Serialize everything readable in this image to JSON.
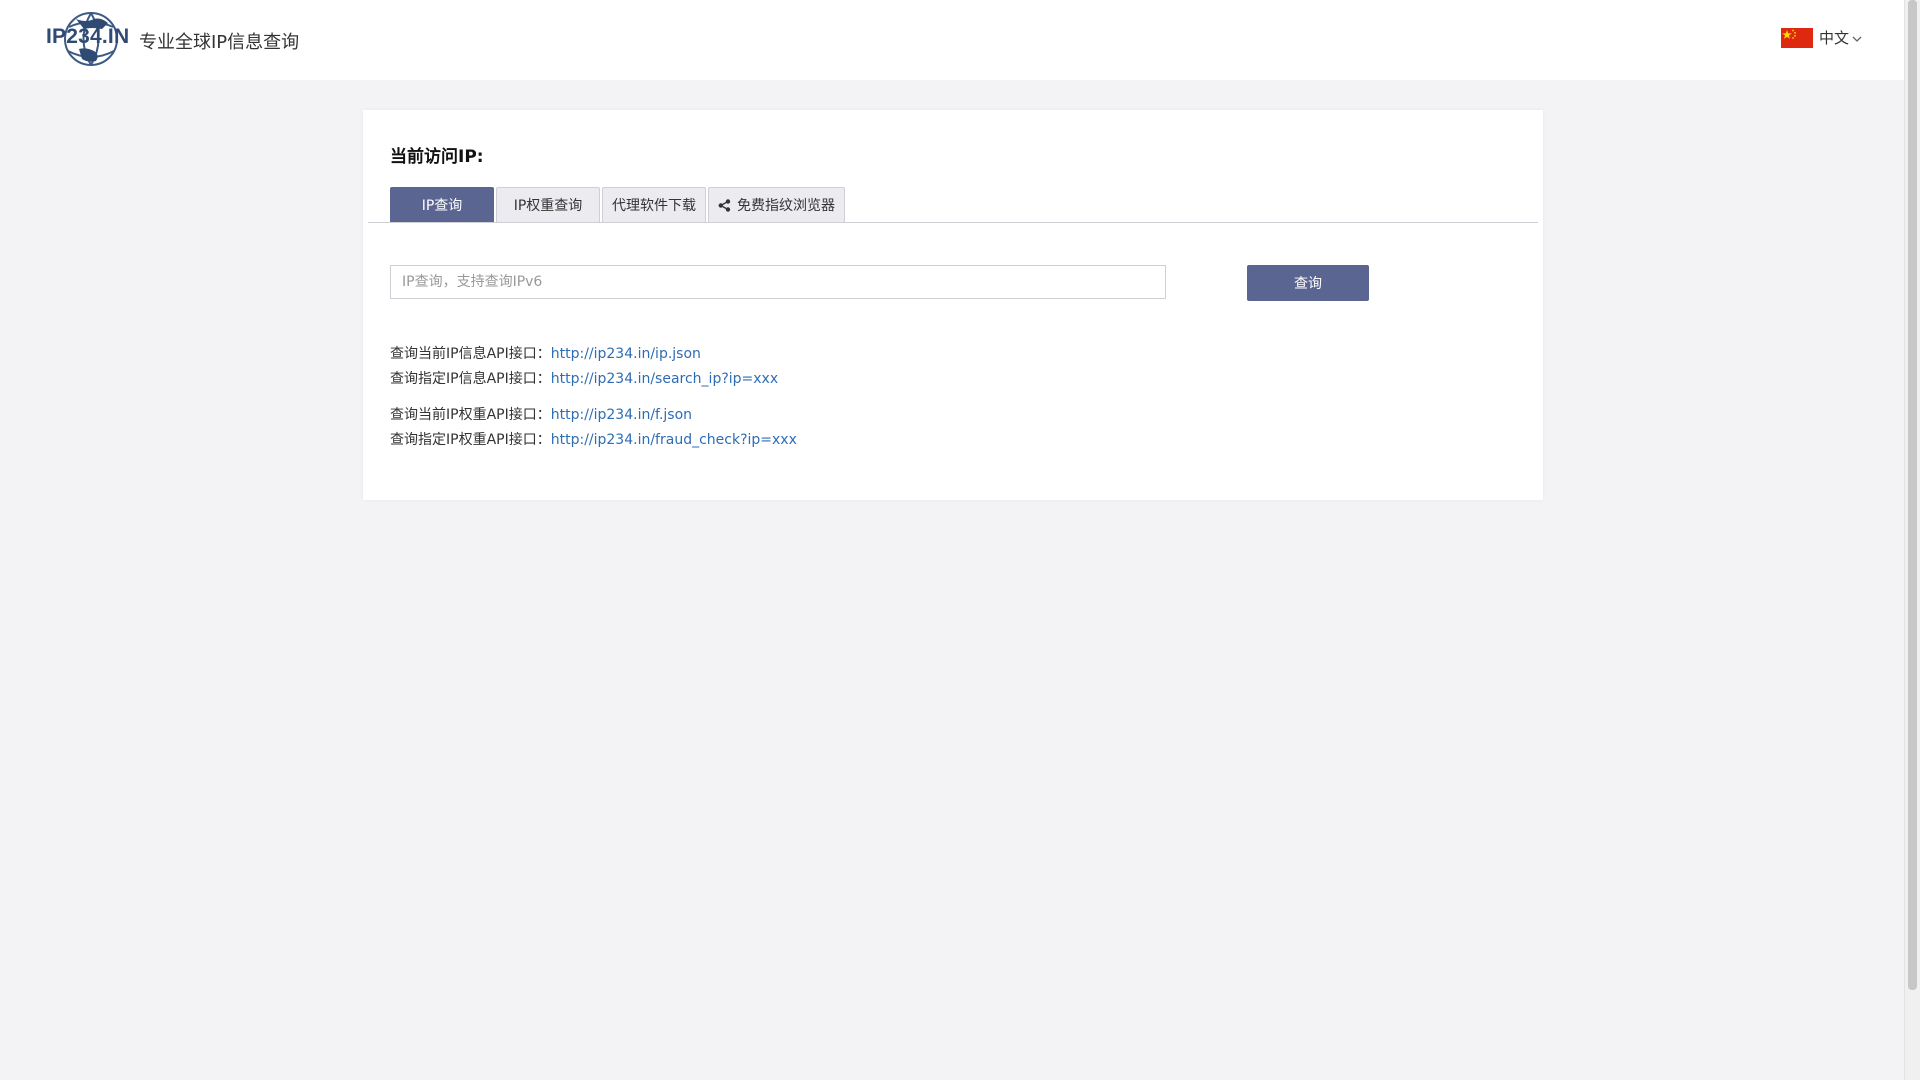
{
  "header": {
    "logo_text": "IP234.IN",
    "tagline": "专业全球IP信息查询",
    "language": "中文"
  },
  "card": {
    "title": "当前访问IP:",
    "tabs": [
      {
        "label": "IP查询",
        "active": true
      },
      {
        "label": "IP权重查询",
        "active": false
      },
      {
        "label": "代理软件下载",
        "active": false
      },
      {
        "label": "免费指纹浏览器",
        "active": false,
        "icon": "share-icon"
      }
    ],
    "search": {
      "placeholder": "IP查询，支持查询IPv6",
      "value": "",
      "button_label": "查询"
    },
    "apis": [
      {
        "label": "查询当前IP信息API接口：",
        "url": "http://ip234.in/ip.json"
      },
      {
        "label": "查询指定IP信息API接口：",
        "url": "http://ip234.in/search_ip?ip=xxx"
      },
      {
        "label": "查询当前IP权重API接口：",
        "url": "http://ip234.in/f.json"
      },
      {
        "label": "查询指定IP权重API接口：",
        "url": "http://ip234.in/fraud_check?ip=xxx"
      }
    ]
  },
  "colors": {
    "accent": "#5a6592",
    "link": "#2e6db4",
    "background": "#f3f3f5",
    "logo": "#2f4a73"
  }
}
